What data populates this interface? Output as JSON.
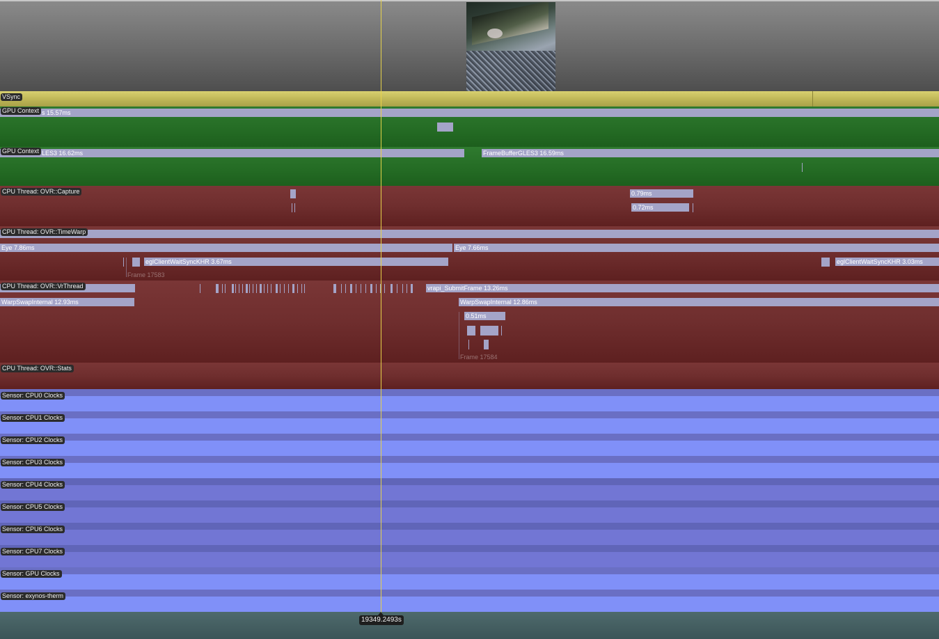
{
  "lanes": {
    "vsync": {
      "label": "VSync"
    },
    "gpu_context_1": {
      "label": "GPU Context",
      "bar_label": "s 15.57ms"
    },
    "gpu_context_2": {
      "label": "GPU Context",
      "bar1_label": "LES3 16.62ms",
      "bar2_label": "FrameBufferGLES3 16.59ms"
    },
    "cpu_capture": {
      "label": "CPU Thread: OVR::Capture",
      "bar1_label": "0.79ms",
      "bar2_label": "0.72ms"
    },
    "cpu_timewarp": {
      "label": "CPU Thread: OVR::TimeWarp",
      "eye1_label": "Eye 7.86ms",
      "eye2_label": "Eye 7.66ms",
      "egl1_label": "eglClientWaitSyncKHR 3.67ms",
      "egl2_label": "eglClientWaitSyncKHR 3.03ms",
      "frame_label": "Frame 17583"
    },
    "cpu_vrthread": {
      "label": "CPU Thread: OVR::VrThread",
      "submit_label": "vrapi_SubmitFrame 13.26ms",
      "warp1_label": "WarpSwapInternal 12.93ms",
      "warp2_label": "WarpSwapInternal 12.86ms",
      "sub_label": "0.51ms",
      "frame_label": "Frame 17584"
    },
    "cpu_stats": {
      "label": "CPU Thread: OVR::Stats"
    }
  },
  "sensors": [
    {
      "label": "Sensor: CPU0 Clocks"
    },
    {
      "label": "Sensor: CPU1 Clocks"
    },
    {
      "label": "Sensor: CPU2 Clocks"
    },
    {
      "label": "Sensor: CPU3 Clocks"
    },
    {
      "label": "Sensor: CPU4 Clocks"
    },
    {
      "label": "Sensor: CPU5 Clocks"
    },
    {
      "label": "Sensor: CPU6 Clocks"
    },
    {
      "label": "Sensor: CPU7 Clocks"
    },
    {
      "label": "Sensor: GPU Clocks"
    },
    {
      "label": "Sensor: exynos-therm"
    }
  ],
  "cursor": {
    "time_label": "19349.2493s"
  },
  "colors": {
    "vsync": "#c8c060",
    "gpu_lane": "#246b24",
    "cpu_lane": "#6f2e2e",
    "sensor_lane": "#8090f8",
    "event_bar": "#a4a4c8",
    "cursor_line": "#e6d24a"
  }
}
